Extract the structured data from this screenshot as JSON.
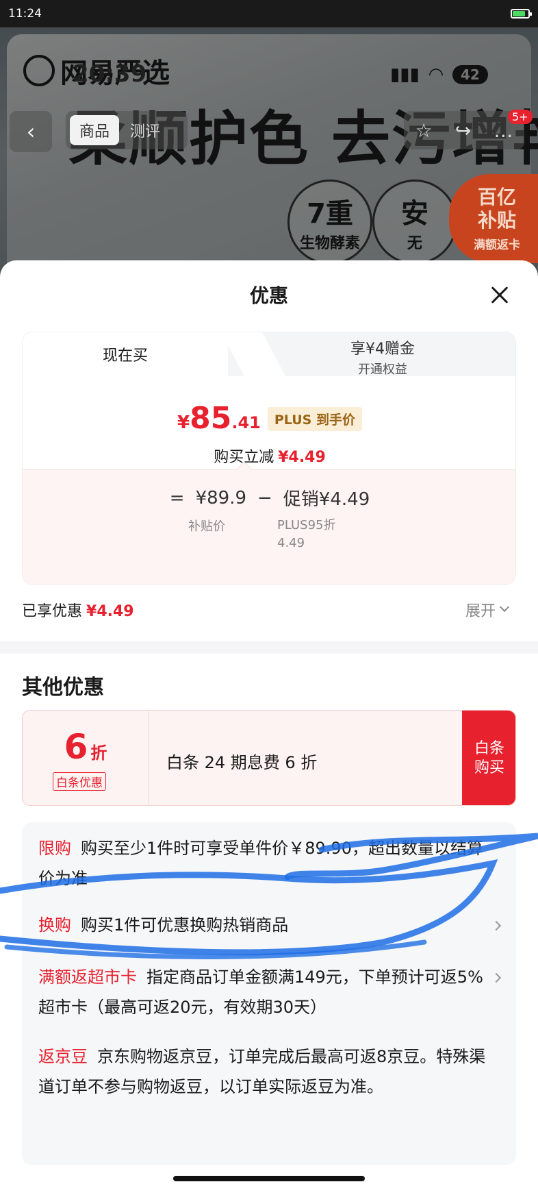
{
  "status_bar": {
    "time": "11:24",
    "battery_level": 0.8
  },
  "background_page": {
    "logo_text": "网易严选",
    "time": "20:39",
    "battery": "42",
    "headline": "柔顺护色 去污增艳",
    "tab_active": "商品",
    "tab_other": "测评",
    "badge": "5+",
    "circle1_big": "7重",
    "circle1_small": "生物酵素",
    "circle2_big": "安",
    "circle2_small": "无",
    "subsidy_line1": "百亿",
    "subsidy_line2": "补贴",
    "subsidy_line3": "满额返卡"
  },
  "sheet": {
    "title": "优惠",
    "tabs": {
      "now": "现在买",
      "plus_line1": "享¥4赠金",
      "plus_line2": "开通权益"
    },
    "price": {
      "symbol": "¥",
      "integer": "85",
      "decimal": ".41",
      "tag": "PLUS 到手价"
    },
    "reduce": {
      "label": "购买立减",
      "amount": "¥4.49"
    },
    "calc": {
      "eq": "=",
      "base": "¥89.9",
      "minus": "−",
      "promo": "促销¥4.49",
      "base_label": "补贴价",
      "promo_label_1": "PLUS95折",
      "promo_label_2": "4.49"
    },
    "enjoyed": {
      "label": "已享优惠",
      "amount": "¥4.49"
    },
    "expand_label": "展开",
    "other_title": "其他优惠",
    "coupon": {
      "discount": "6",
      "unit": "折",
      "tag": "白条优惠",
      "desc": "白条 24 期息费 6 折",
      "button": "白条购买"
    },
    "promos": [
      {
        "tag": "限购",
        "text": "购买至少1件时可享受单件价￥89.90，超出数量以结算价为准"
      },
      {
        "tag": "换购",
        "text": "购买1件可优惠换购热销商品"
      },
      {
        "tag": "满额返超市卡",
        "text": "指定商品订单金额满149元，下单预计可返5%超市卡（最高可返20元，有效期30天）"
      },
      {
        "tag": "返京豆",
        "text": "京东购物返京豆，订单完成后最高可返8京豆。特殊渠道订单不参与购物返豆，以订单实际返豆为准。"
      }
    ]
  },
  "colors": {
    "accent_red": "#e8212e",
    "plus_gold": "#9a6416",
    "scribble_blue": "#1f6fe6"
  }
}
